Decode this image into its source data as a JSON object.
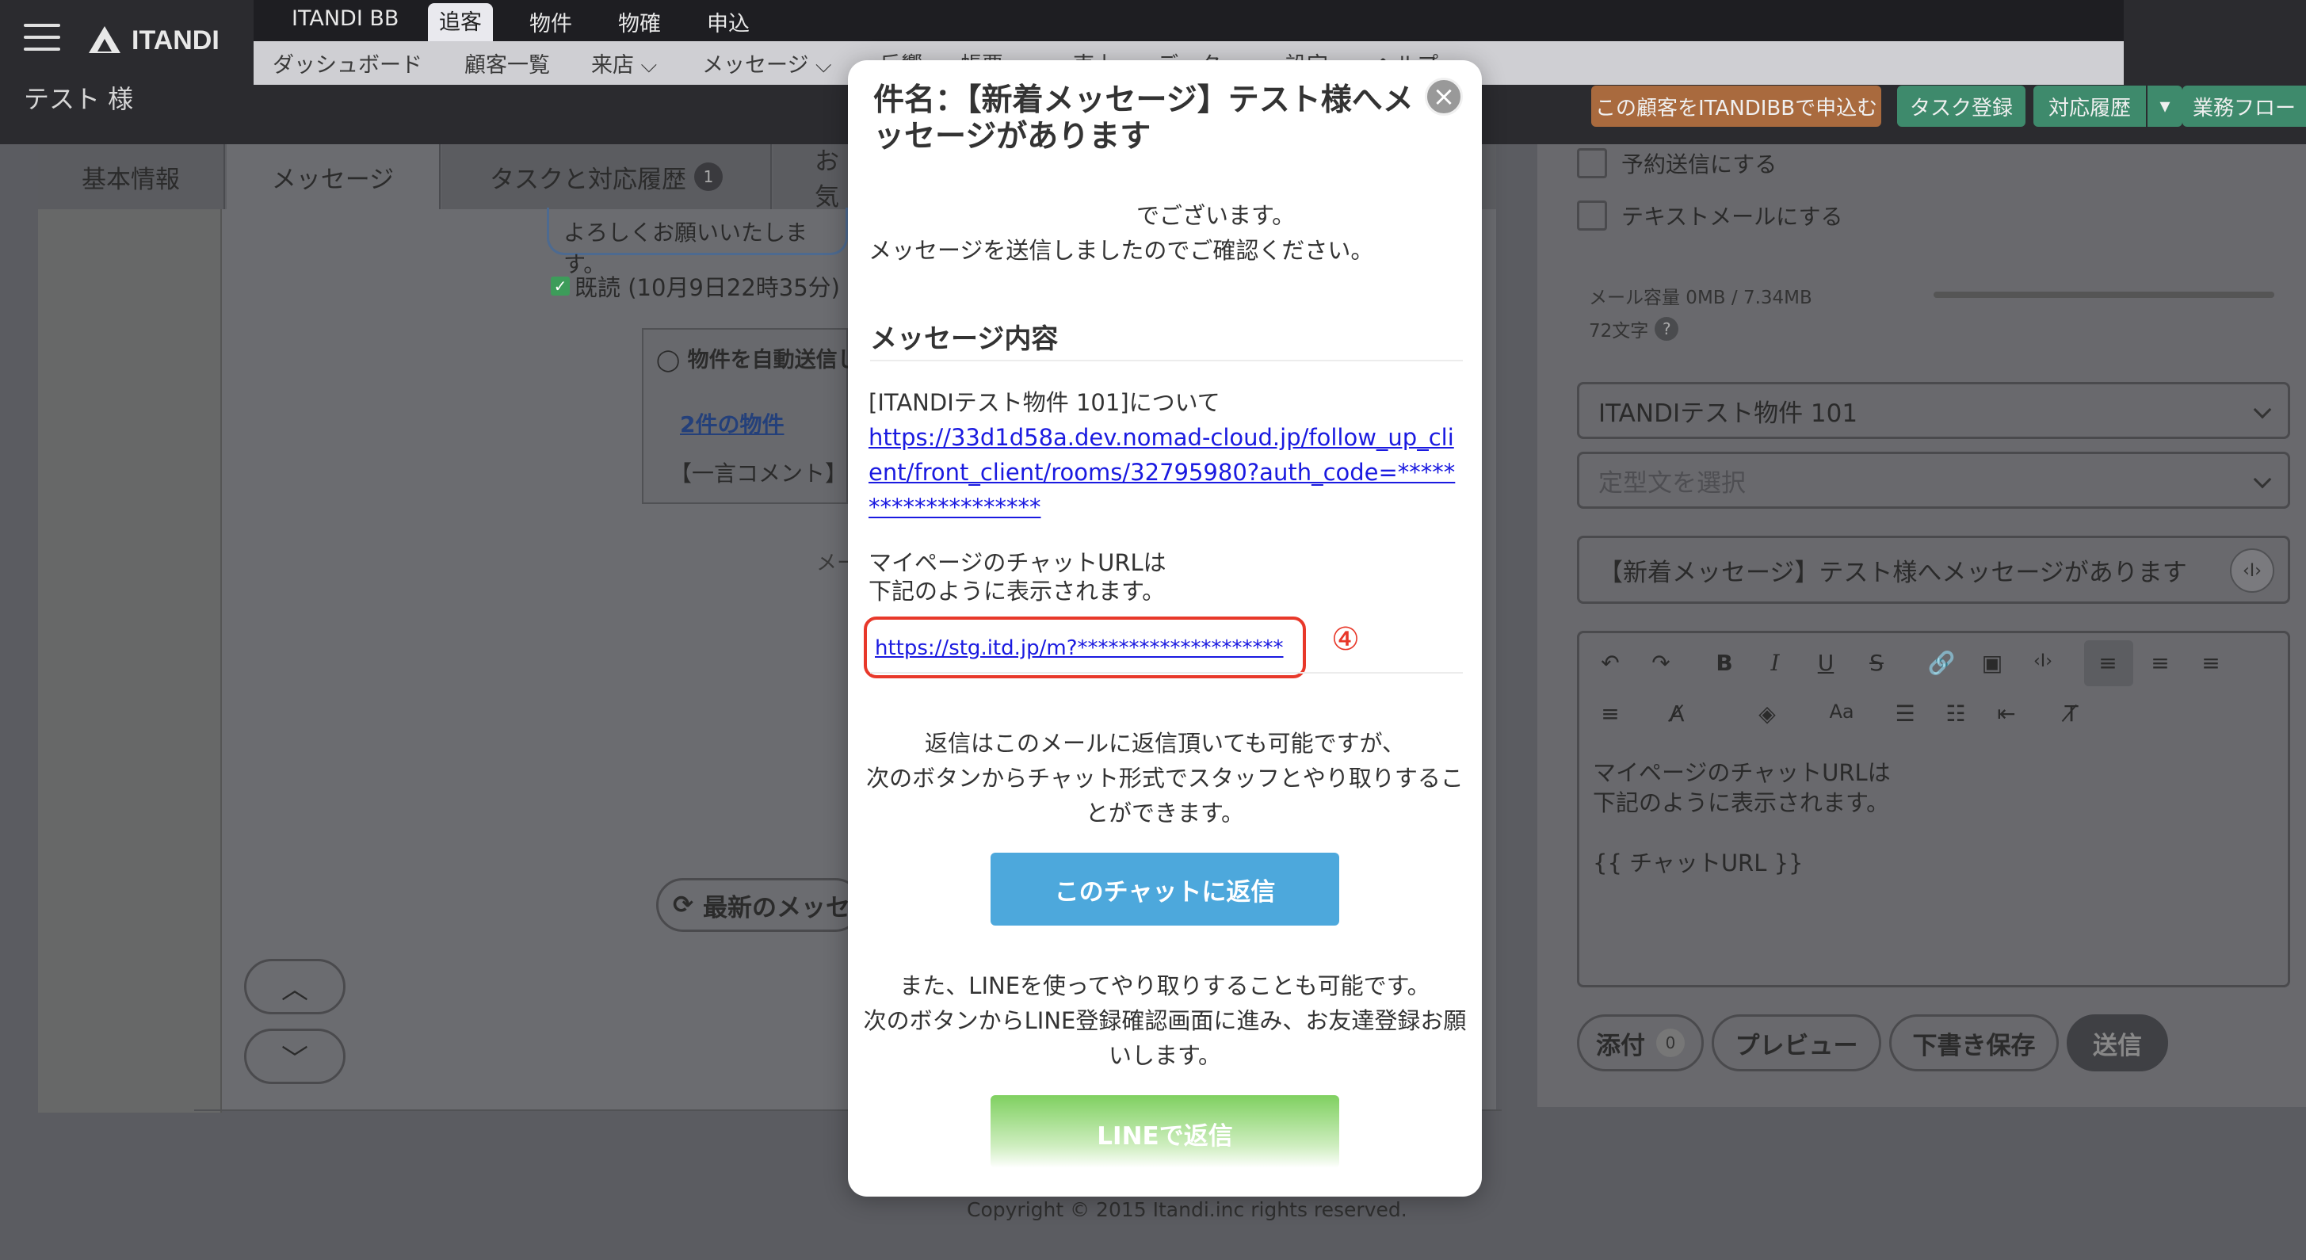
{
  "header": {
    "logo_text": "ITANDI",
    "top_nav": [
      "ITANDI BB",
      "追客",
      "物件",
      "物確",
      "申込"
    ],
    "top_nav_active": "追客",
    "sub_nav": [
      "ダッシュボード",
      "顧客一覧",
      "来店 ⌵",
      "メッセージ ⌵",
      "反響",
      "帳票",
      "売上",
      "データ",
      "設定",
      "ヘルプ"
    ],
    "customer_name": "テスト 様",
    "buttons": [
      {
        "label": "この顧客をITANDIBBで申込む",
        "color": "#a96a3e"
      },
      {
        "label": "タスク登録",
        "color": "#3e8a6c"
      },
      {
        "label": "対応履歴",
        "color": "#3e8a6c"
      },
      {
        "label": "業務フロー",
        "color": "#3e8a6c"
      }
    ]
  },
  "tabs": [
    {
      "label": "基本情報"
    },
    {
      "label": "メッセージ"
    },
    {
      "label": "タスクと対応履歴",
      "badge": "1"
    },
    {
      "label": "お気"
    }
  ],
  "messages": {
    "bubble_text": "よろしくお願いいたします。",
    "read_status": "既読 (10月9日22時35分)",
    "property_box_title": "物件を自動送信し",
    "property_link": "2件の物件",
    "property_comment": "【一言コメント】",
    "fragment": "メー",
    "latest_button": "最新のメッセ",
    "scroll_up": "︿",
    "scroll_down": "﹀"
  },
  "right_panel": {
    "reserve_send": "予約送信にする",
    "text_mail": "テキストメールにする",
    "capacity": "メール容量 0MB / 7.34MB",
    "char_count": "72文字",
    "help_icon": "?",
    "property_select": "ITANDIテスト物件 101",
    "template_placeholder": "定型文を選択",
    "subject": "【新着メッセージ】テスト様へメッセージがあります",
    "editor_text": "マイページのチャットURLは\n下記のように表示されます。\n\n{{ チャットURL }}",
    "toolbar": [
      "↶",
      "↷",
      "B",
      "I",
      "U",
      "S",
      "🔗",
      "▣",
      "‹I›",
      "≡",
      "≡",
      "≡",
      "≡",
      "A̸",
      "◈",
      "Aa",
      "☰",
      "☷",
      "⇤",
      "T̸"
    ],
    "attach_label": "添付",
    "attach_count": "0",
    "preview_label": "プレビュー",
    "draft_label": "下書き保存",
    "send_label": "送信"
  },
  "modal": {
    "title": "件名：【新着メッセージ】テスト様へメッセージがあります",
    "close": "×",
    "greeting": "でございます。",
    "notice": "メッセージを送信しましたのでご確認ください。",
    "content_heading": "メッセージ内容",
    "property_line": "[ITANDIテスト物件 101]について",
    "follow_link": "https://33d1d58a.dev.nomad-cloud.jp/follow_up_client/front_client/rooms/32795980?auth_code=********************",
    "mypage_line1": "マイページのチャットURLは",
    "mypage_line2": "下記のように表示されます。",
    "chat_url": "https://stg.itd.jp/m?********************",
    "annotation": "④",
    "reply_text_1": "返信はこのメールに返信頂いても可能ですが、",
    "reply_text_2": "次のボタンからチャット形式でスタッフとやり取りするこ",
    "reply_text_3": "とができます。",
    "chat_reply_button": "このチャットに返信",
    "line_text_1": "また、LINEを使ってやり取りすることも可能です。",
    "line_text_2": "次のボタンからLINE登録確認画面に進み、お友達登録お願",
    "line_text_3": "いします。",
    "line_reply_button": "LINEで返信"
  },
  "footer": {
    "copyright": "Copyright © 2015 Itandi.inc rights reserved."
  }
}
